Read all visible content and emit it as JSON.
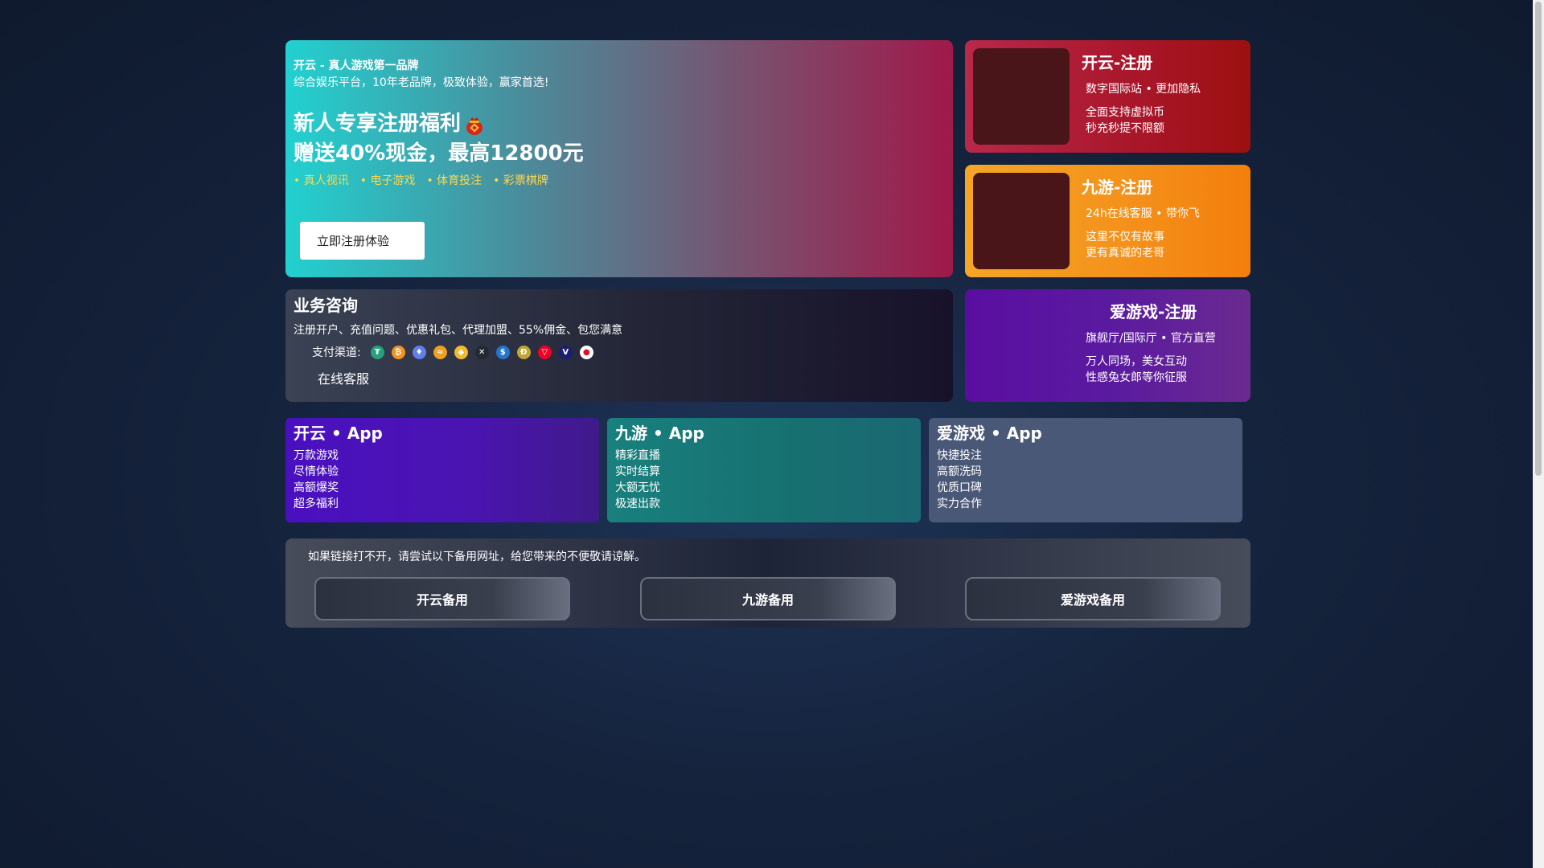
{
  "hero": {
    "brand": "开云 - 真人游戏第一品牌",
    "subtitle": "综合娱乐平台，10年老品牌，极致体验，赢家首选!",
    "headline1": "新人专享注册福利",
    "headline2": "赠送40%现金，最高12800元",
    "tags": [
      "真人视讯",
      "电子游戏",
      "体育投注",
      "彩票棋牌"
    ],
    "register_button": "立即注册体验"
  },
  "brand_cards": [
    {
      "title": "开云-注册",
      "line1": "数字国际站  • 更加隐私",
      "line2a": "全面支持虚拟币",
      "line2b": "秒充秒提不限额"
    },
    {
      "title": "九游-注册",
      "line1": "24h在线客服  • 带你飞",
      "line2a": "这里不仅有故事",
      "line2b": "更有真诚的老哥"
    },
    {
      "title": "爱游戏-注册",
      "line1": "旗舰厅/国际厅  • 官方直营",
      "line2a": "万人同场，美女互动",
      "line2b": "性感兔女郎等你征服"
    }
  ],
  "consult": {
    "title": "业务咨询",
    "description": "注册开户、充值问题、优惠礼包、代理加盟、55%佣金、包您满意",
    "payment_label": "支付渠道:",
    "payment_icons": [
      {
        "name": "tether-icon",
        "color": "#26a17b",
        "glyph": "₮"
      },
      {
        "name": "bitcoin-icon",
        "color": "#f7931a",
        "glyph": "₿"
      },
      {
        "name": "ethereum-icon",
        "color": "#627eea",
        "glyph": "♦"
      },
      {
        "name": "gold-coin-icon",
        "color": "#f0a020",
        "glyph": "≈"
      },
      {
        "name": "bnb-icon",
        "color": "#f3ba2f",
        "glyph": "◆"
      },
      {
        "name": "xrp-icon",
        "color": "#23292f",
        "glyph": "✕"
      },
      {
        "name": "usdc-icon",
        "color": "#2775ca",
        "glyph": "$"
      },
      {
        "name": "dogecoin-icon",
        "color": "#c2a633",
        "glyph": "Ð"
      },
      {
        "name": "tron-icon",
        "color": "#ef0027",
        "glyph": "▽"
      },
      {
        "name": "visa-icon",
        "color": "#1a1f71",
        "glyph": "V"
      },
      {
        "name": "mastercard-icon",
        "color": "#ffffff",
        "glyph": "●"
      }
    ],
    "online_service": "在线客服"
  },
  "apps": [
    {
      "brand": "开云",
      "suffix": " • App",
      "features": [
        "万款游戏",
        "尽情体验",
        "高额爆奖",
        "超多福利"
      ]
    },
    {
      "brand": "九游",
      "suffix": " • App",
      "features": [
        "精彩直播",
        "实时结算",
        "大额无忧",
        "极速出款"
      ]
    },
    {
      "brand": "爱游戏",
      "suffix": " • App",
      "features": [
        "快捷投注",
        "高额洗码",
        "优质口碑",
        "实力合作"
      ]
    }
  ],
  "backup": {
    "note": "如果链接打不开，请尝试以下备用网址，给您带来的不便敬请谅解。",
    "buttons": [
      "开云备用",
      "九游备用",
      "爱游戏备用"
    ]
  }
}
